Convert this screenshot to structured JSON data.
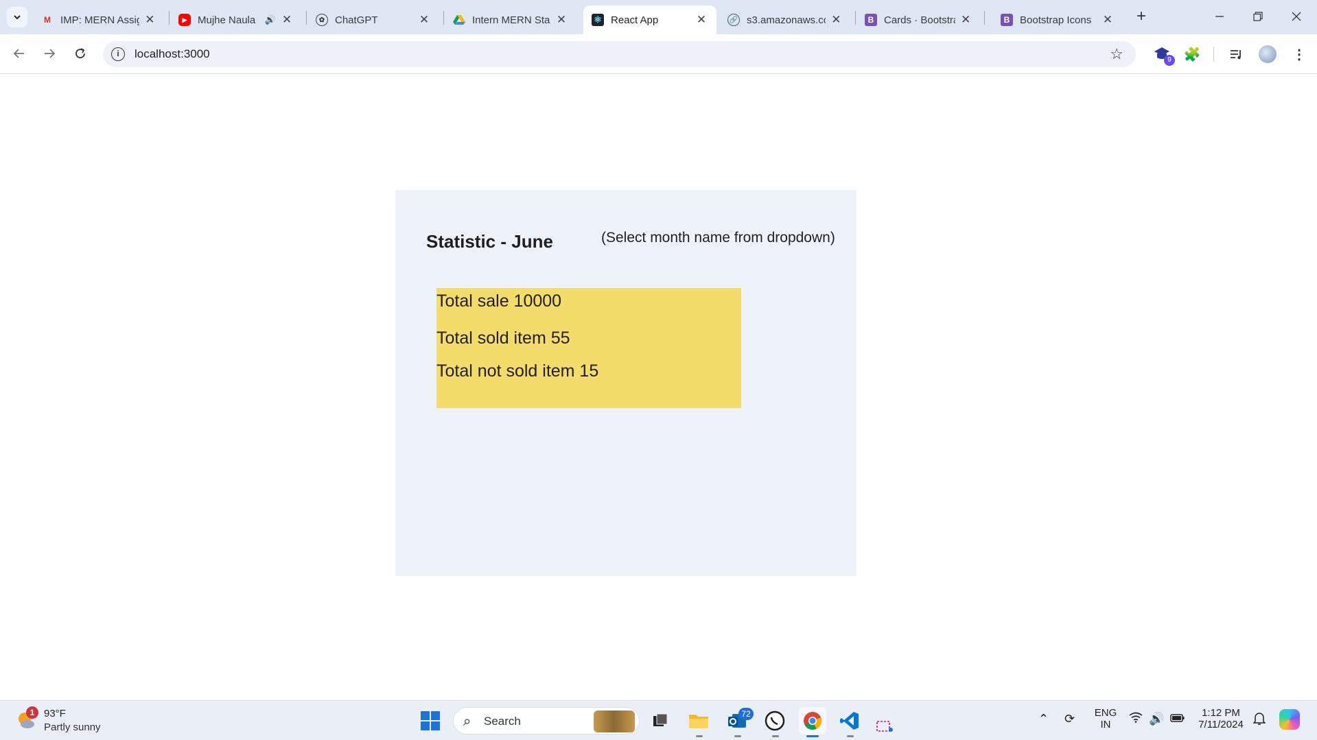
{
  "browser": {
    "tabs": [
      {
        "title": "IMP: MERN Assig",
        "favicon": "gmail-icon"
      },
      {
        "title": "Mujhe Naula",
        "favicon": "youtube-icon"
      },
      {
        "title": "ChatGPT",
        "favicon": "chatgpt-icon"
      },
      {
        "title": "Intern MERN Sta",
        "favicon": "google-drive-icon"
      },
      {
        "title": "React App",
        "favicon": "react-icon",
        "active": true
      },
      {
        "title": "s3.amazonaws.co",
        "favicon": "globe-icon"
      },
      {
        "title": "Cards · Bootstrap",
        "favicon": "bootstrap-icon"
      },
      {
        "title": "Bootstrap Icons",
        "favicon": "bootstrap-icon"
      }
    ],
    "url": "localhost:3000",
    "extension_badge": "9"
  },
  "page": {
    "title": "Statistic - June",
    "hint": "(Select month name from dropdown)",
    "stats": {
      "total_sale": "Total sale 10000",
      "total_sold": "Total sold item 55",
      "total_not_sold": "Total not sold item 15"
    }
  },
  "taskbar": {
    "weather": {
      "temp": "93°F",
      "desc": "Partly sunny",
      "badge": "1"
    },
    "search_label": "Search",
    "outlook_badge": "72",
    "lang_top": "ENG",
    "lang_bottom": "IN",
    "time": "1:12 PM",
    "date": "7/11/2024"
  },
  "colors": {
    "panel_bg": "#edf3f9",
    "card_bg": "#f4dc6b",
    "tabstrip_bg": "#dfe7f5",
    "accent": "#1f6fd6"
  }
}
